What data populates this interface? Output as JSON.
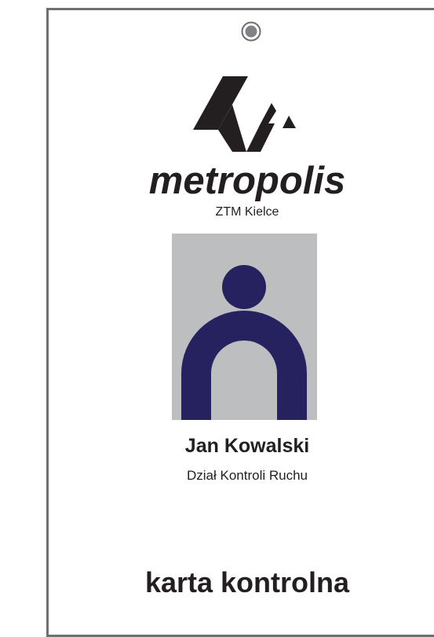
{
  "brand": {
    "name": "metropolis",
    "organization": "ZTM Kielce",
    "logo_icon": "metropolis-logo-icon"
  },
  "holder": {
    "name": "Jan Kowalski",
    "department": "Dział Kontroli Ruchu",
    "photo_icon": "person-silhouette-icon"
  },
  "card": {
    "type_label": "karta kontrolna",
    "hole_icon": "lanyard-hole-icon"
  },
  "colors": {
    "ink": "#231f20",
    "silhouette": "#25225f",
    "photo_bg": "#bcbec0",
    "border": "#6f6f6f"
  }
}
